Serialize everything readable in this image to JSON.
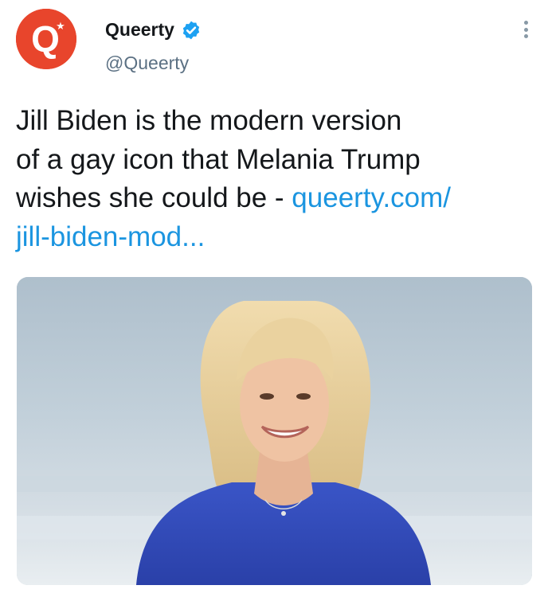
{
  "account": {
    "display_name": "Queerty",
    "handle": "@Queerty",
    "avatar_letter": "Q",
    "avatar_color": "#e8452c",
    "verified_color": "#1da1f2"
  },
  "tweet": {
    "text_line_1": "Jill Biden is the modern version",
    "text_line_2": "of a gay icon that Melania Trump",
    "text_line_3": "wishes she could be - ",
    "link_part_1": "queerty.com/",
    "link_part_2": "jill-biden-mod..."
  },
  "colors": {
    "link": "#1b95e0",
    "text": "#14171a",
    "secondary": "#5b7083"
  },
  "icons": {
    "more": "more-vertical-icon",
    "verified": "verified-badge-icon"
  }
}
